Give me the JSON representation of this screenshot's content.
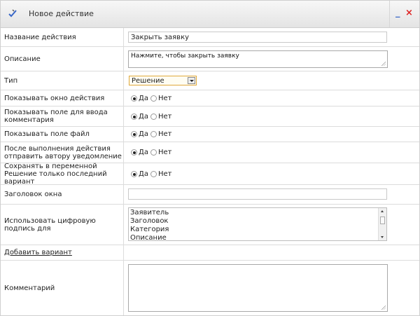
{
  "window": {
    "title": "Новое действие",
    "minimize_glyph": "_",
    "close_glyph": "×",
    "title_icon": "pencil-check-icon"
  },
  "form": {
    "action_name": {
      "label": "Название действия",
      "value": "Закрыть заявку"
    },
    "description": {
      "label": "Описание",
      "value": "Нажмите, чтобы закрыть заявку"
    },
    "type": {
      "label": "Тип",
      "value": "Решение"
    },
    "show_action_window": {
      "label": "Показывать окно действия",
      "yes": "Да",
      "no": "Нет",
      "selected": "yes"
    },
    "show_comment_field": {
      "label": "Показывать поле для ввода комментария",
      "yes": "Да",
      "no": "Нет",
      "selected": "yes"
    },
    "show_file_field": {
      "label": "Показывать поле файл",
      "yes": "Да",
      "no": "Нет",
      "selected": "yes"
    },
    "notify_author": {
      "label": "После выполнения действия отправить автору уведомление",
      "yes": "Да",
      "no": "Нет",
      "selected": "yes"
    },
    "keep_last_variant": {
      "label": "Сохранять в переменной Решение только последний вариант",
      "yes": "Да",
      "no": "Нет",
      "selected": "yes"
    },
    "window_header": {
      "label": "Заголовок окна",
      "value": ""
    },
    "digital_signature": {
      "label": "Использовать цифровую подпись для",
      "options": [
        "Заявитель",
        "Заголовок",
        "Категория",
        "Описание"
      ]
    },
    "add_variant": {
      "label": "Добавить вариант"
    },
    "comment": {
      "label": "Комментарий",
      "value": ""
    }
  },
  "colors": {
    "select_border": "#e0a83a",
    "close": "#dd2222",
    "minimize": "#3a68c8"
  }
}
